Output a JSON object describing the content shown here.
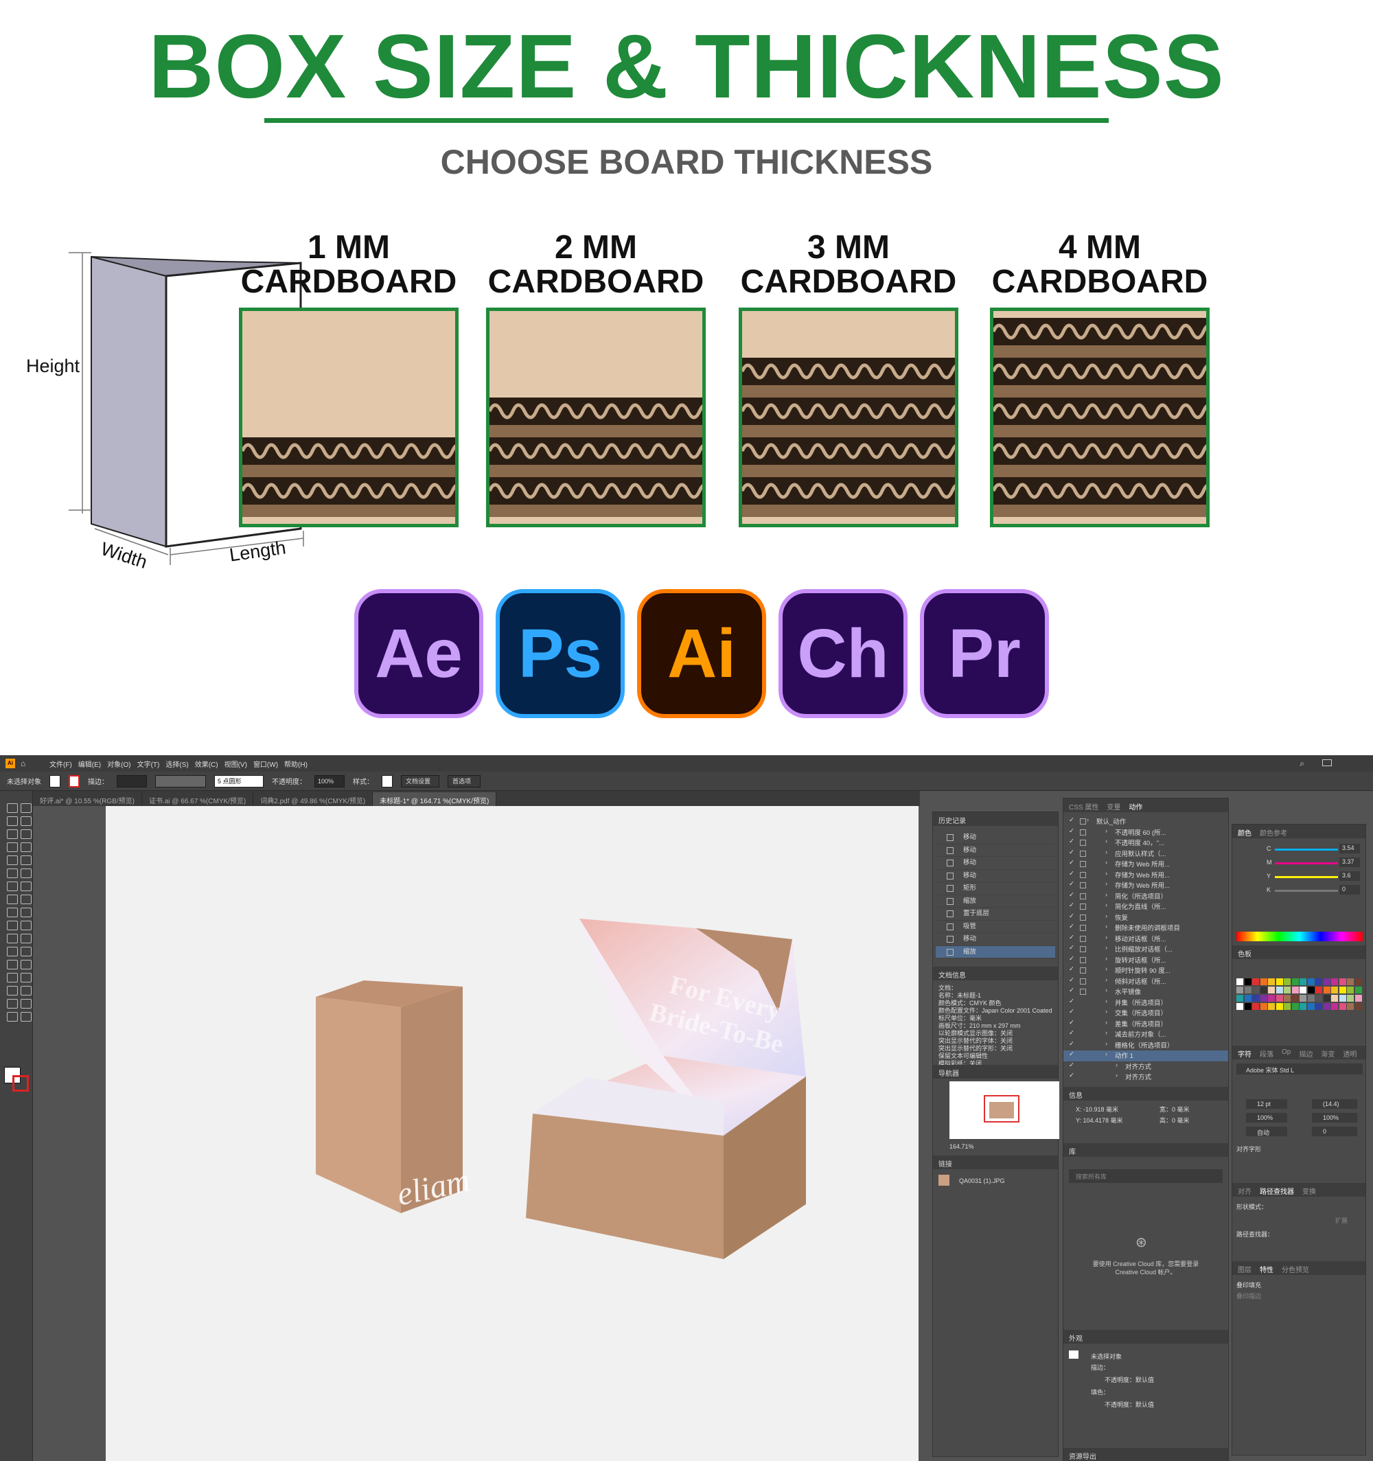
{
  "header": {
    "title": "BOX SIZE & THICKNESS",
    "subtitle": "CHOOSE BOARD THICKNESS"
  },
  "box_diagram": {
    "height_label": "Height",
    "width_label": "Width",
    "length_label": "Length"
  },
  "thickness_options": [
    {
      "line1": "1 MM",
      "line2": "CARDBOARD",
      "flutes": 2
    },
    {
      "line1": "2 MM",
      "line2": "CARDBOARD",
      "flutes": 3
    },
    {
      "line1": "3 MM",
      "line2": "CARDBOARD",
      "flutes": 4
    },
    {
      "line1": "4 MM",
      "line2": "CARDBOARD",
      "flutes": 5
    }
  ],
  "apps": [
    {
      "abbr": "Ae",
      "bg": "#2a0a57",
      "border": "#c78ef8",
      "fg": "#c99ff8"
    },
    {
      "abbr": "Ps",
      "bg": "#03234a",
      "border": "#31a8ff",
      "fg": "#31a8ff"
    },
    {
      "abbr": "Ai",
      "bg": "#2a0e00",
      "border": "#ff7c00",
      "fg": "#ff9a00"
    },
    {
      "abbr": "Ch",
      "bg": "#2a0a57",
      "border": "#c78ef8",
      "fg": "#c99ff8"
    },
    {
      "abbr": "Pr",
      "bg": "#2a0a57",
      "border": "#c78ef8",
      "fg": "#c99ff8"
    }
  ],
  "illustrator": {
    "logo": "Ai",
    "menu": [
      "文件(F)",
      "编辑(E)",
      "对象(O)",
      "文字(T)",
      "选择(S)",
      "效果(C)",
      "视图(V)",
      "窗口(W)",
      "帮助(H)"
    ],
    "control_bar": {
      "selection": "未选择对象",
      "stroke_label": "描边：",
      "brush": "5 点圆形",
      "opacity_label": "不透明度：",
      "opacity_value": "100%",
      "style_label": "样式：",
      "doc_setup": "文档设置",
      "prefs": "首选项"
    },
    "doc_tabs": [
      {
        "label": "好评.ai* @ 10.55 %(RGB/预览)",
        "active": false
      },
      {
        "label": "证书.ai @ 66.67 %(CMYK/预览)",
        "active": false
      },
      {
        "label": "词典2.pdf @ 49.86 %(CMYK/预览)",
        "active": false
      },
      {
        "label": "未标题-1* @ 164.71 %(CMYK/预览)",
        "active": true
      }
    ],
    "artwork": {
      "lid_text_1": "For Every",
      "lid_text_2": "Bride-To-Be",
      "brand": "eliam"
    },
    "history": {
      "title": "历史记录",
      "items": [
        "移动",
        "移动",
        "移动",
        "移动",
        "矩形",
        "缩放",
        "置于底层",
        "吸管",
        "移动",
        "缩放"
      ]
    },
    "doc_info": {
      "title": "文档信息",
      "lines": [
        "文档：",
        "名称：未标题-1",
        "颜色模式：CMYK 颜色",
        "颜色配置文件：Japan Color 2001 Coated",
        "标尺单位：毫米",
        "画板尺寸：210 mm x 297 mm",
        "以轮廓模式显示图像：关闭",
        "突出显示替代的字体：关闭",
        "突出显示替代的字形：关闭",
        "保留文本可编辑性",
        "模拟彩纸：关闭"
      ]
    },
    "navigator": {
      "title": "导航器",
      "zoom": "164.71%"
    },
    "links": {
      "title": "链接",
      "file": "QA0031 (1).JPG"
    },
    "actions": {
      "tabs": [
        "CSS 属性",
        "变量",
        "动作"
      ],
      "items": [
        "默认_动作",
        "不透明度 60 (所...",
        "不透明度 40，\"...",
        "应用默认样式（...",
        "存储为 Web 所用...",
        "存储为 Web 所用...",
        "存储为 Web 所用...",
        "简化（所选项目）",
        "简化为直线（所...",
        "恢复",
        "删除未使用的调板项目",
        "移动对话框（所...",
        "比例缩放对话框（...",
        "旋转对话框（所...",
        "顺时针旋转 90 度...",
        "倾斜对话框（所...",
        "水平镜像",
        "并集（所选项目）",
        "交集（所选项目）",
        "差集（所选项目）",
        "减去前方对象（...",
        "栅格化（所选项目）",
        "动作 1",
        "对齐方式",
        "对齐方式"
      ]
    },
    "info": {
      "title": "信息",
      "x": "X: -10.918 毫米",
      "y": "Y: 104.4178 毫米",
      "w": "宽：0 毫米",
      "h": "高：0 毫米"
    },
    "library": {
      "title": "库",
      "search": "搜索所有库",
      "message": "要使用 Creative Cloud 库，您需要登录 Creative Cloud 帐户。"
    },
    "appearance": {
      "title": "外观",
      "object": "未选择对象",
      "stroke": "描边：",
      "opacity": "不透明度：默认值",
      "fill": "填色：",
      "opacity2": "不透明度：默认值"
    },
    "asset_export": "资源导出",
    "color": {
      "tabs": [
        "颜色",
        "颜色参考"
      ],
      "channels": [
        {
          "k": "C",
          "v": "3.54"
        },
        {
          "k": "M",
          "v": "3.37"
        },
        {
          "k": "Y",
          "v": "3.6"
        },
        {
          "k": "K",
          "v": "0"
        }
      ]
    },
    "swatches": {
      "title": "色板"
    },
    "character": {
      "tabs": [
        "字符",
        "段落",
        "Op",
        "描边",
        "渐变",
        "透明"
      ],
      "font": "Adobe 宋体 Std L",
      "size": "12 pt",
      "leading": "(14.4)",
      "scale_h": "100%",
      "scale_v": "100%",
      "tracking": "自动",
      "kerning": "0",
      "align_label": "对齐字形"
    },
    "align_panel": {
      "tabs": [
        "对齐",
        "路径查找器",
        "变换"
      ],
      "shape_modes": "形状模式：",
      "pathfinder": "路径查找器：",
      "expand": "扩展"
    },
    "attributes": {
      "tabs": [
        "图层",
        "特性",
        "分色预览"
      ],
      "overprint_fill": "叠印填充",
      "overprint_stroke": "叠印描边"
    }
  }
}
